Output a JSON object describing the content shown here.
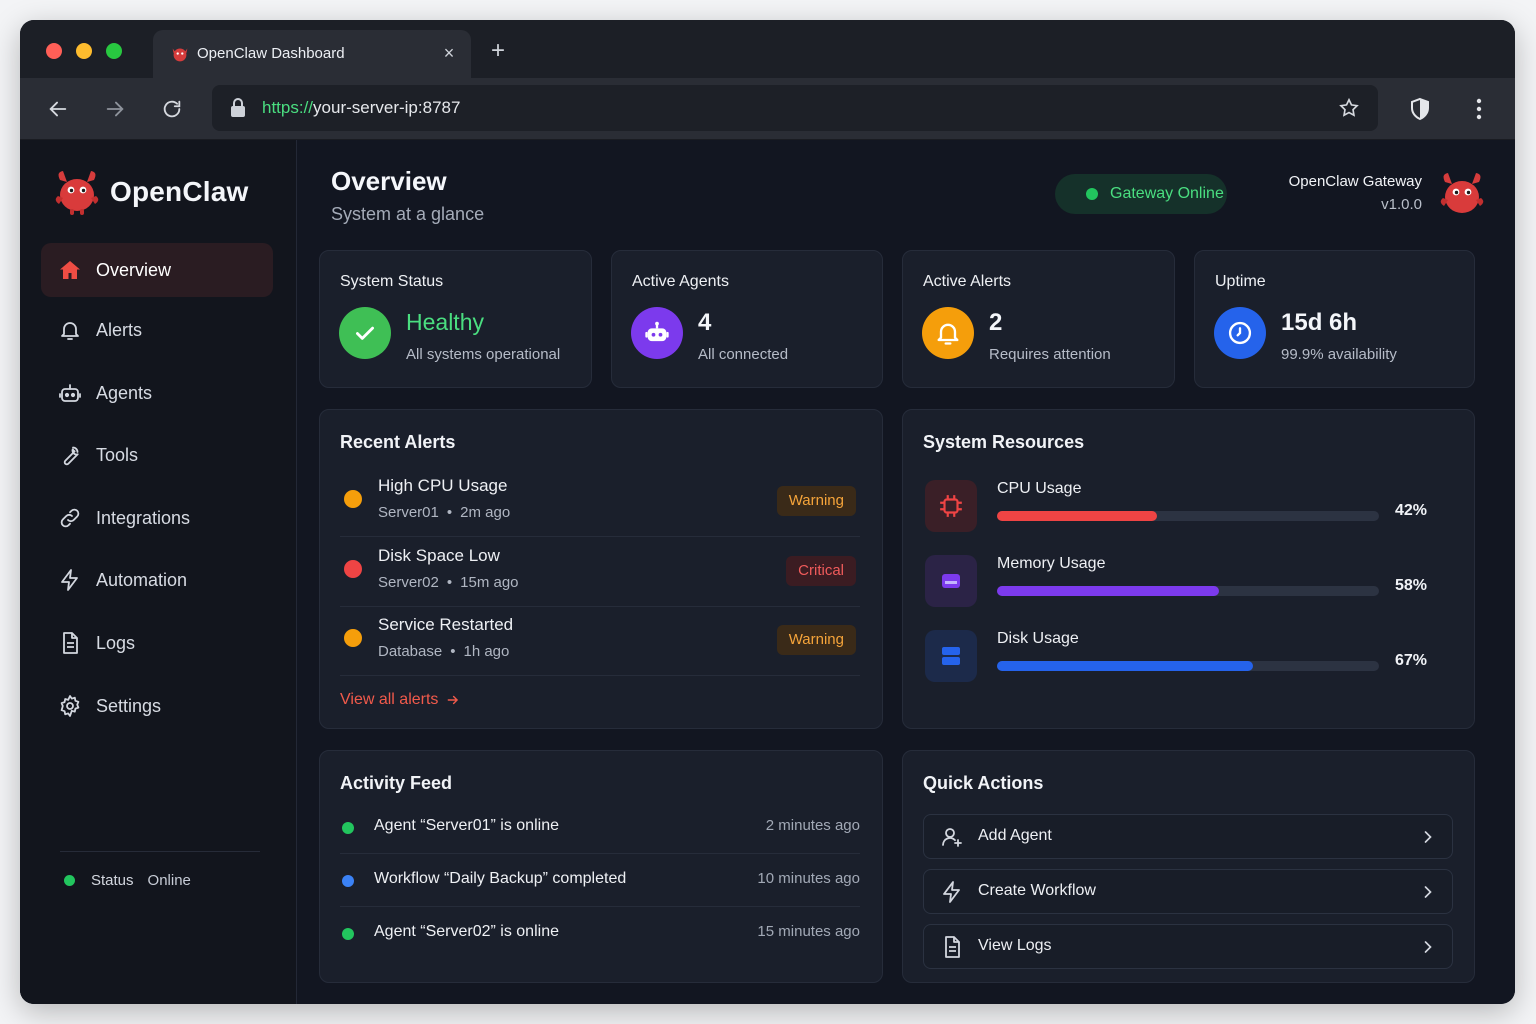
{
  "browser": {
    "tab_title": "OpenClaw Dashboard",
    "tab_close": "×",
    "new_tab": "+",
    "url_scheme": "https://",
    "url_rest": "your-server-ip:8787"
  },
  "sidebar": {
    "brand": "OpenClaw",
    "items": [
      {
        "label": "Overview",
        "icon": "home-icon"
      },
      {
        "label": "Alerts",
        "icon": "bell-icon"
      },
      {
        "label": "Agents",
        "icon": "robot-icon"
      },
      {
        "label": "Tools",
        "icon": "wrench-icon"
      },
      {
        "label": "Integrations",
        "icon": "link-icon"
      },
      {
        "label": "Automation",
        "icon": "bolt-icon"
      },
      {
        "label": "Logs",
        "icon": "document-icon"
      },
      {
        "label": "Settings",
        "icon": "gear-icon"
      }
    ],
    "status_label": "Status",
    "status_value": "Online"
  },
  "header": {
    "title": "Overview",
    "subtitle": "System at a glance",
    "gateway_status": "Gateway Online",
    "gateway_name": "OpenClaw Gateway",
    "gateway_version": "v1.0.0"
  },
  "stats": [
    {
      "title": "System Status",
      "value": "Healthy",
      "sub": "All systems operational",
      "color": "#3fbf55"
    },
    {
      "title": "Active Agents",
      "value": "4",
      "sub": "All connected",
      "color": "#7c3aed"
    },
    {
      "title": "Active Alerts",
      "value": "2",
      "sub": "Requires attention",
      "color": "#f59e0b"
    },
    {
      "title": "Uptime",
      "value": "15d 6h",
      "sub": "99.9% availability",
      "color": "#2563eb"
    }
  ],
  "recent_alerts": {
    "title": "Recent Alerts",
    "items": [
      {
        "title": "High CPU Usage",
        "source": "Server01",
        "time": "2m ago",
        "badge": "Warning",
        "severity": "warning"
      },
      {
        "title": "Disk Space Low",
        "source": "Server02",
        "time": "15m ago",
        "badge": "Critical",
        "severity": "critical"
      },
      {
        "title": "Service Restarted",
        "source": "Database",
        "time": "1h ago",
        "badge": "Warning",
        "severity": "warning"
      }
    ],
    "view_all": "View all alerts",
    "separator": "•"
  },
  "resources": {
    "title": "System Resources",
    "items": [
      {
        "label": "CPU Usage",
        "value": "42%",
        "percent": 42,
        "color": "#ef4444",
        "icon": "cpu-icon"
      },
      {
        "label": "Memory Usage",
        "value": "58%",
        "percent": 58,
        "color": "#7c3aed",
        "icon": "memory-icon"
      },
      {
        "label": "Disk Usage",
        "value": "67%",
        "percent": 67,
        "color": "#2563eb",
        "icon": "disk-icon"
      }
    ]
  },
  "activity": {
    "title": "Activity Feed",
    "items": [
      {
        "text": "Agent “Server01” is online",
        "time": "2 minutes ago",
        "color": "#22c55e"
      },
      {
        "text": "Workflow “Daily Backup” completed",
        "time": "10 minutes ago",
        "color": "#3b82f6"
      },
      {
        "text": "Agent “Server02” is online",
        "time": "15 minutes ago",
        "color": "#22c55e"
      }
    ]
  },
  "quick_actions": {
    "title": "Quick Actions",
    "items": [
      {
        "label": "Add Agent",
        "icon": "user-plus-icon"
      },
      {
        "label": "Create Workflow",
        "icon": "bolt-icon"
      },
      {
        "label": "View Logs",
        "icon": "document-icon"
      }
    ]
  }
}
